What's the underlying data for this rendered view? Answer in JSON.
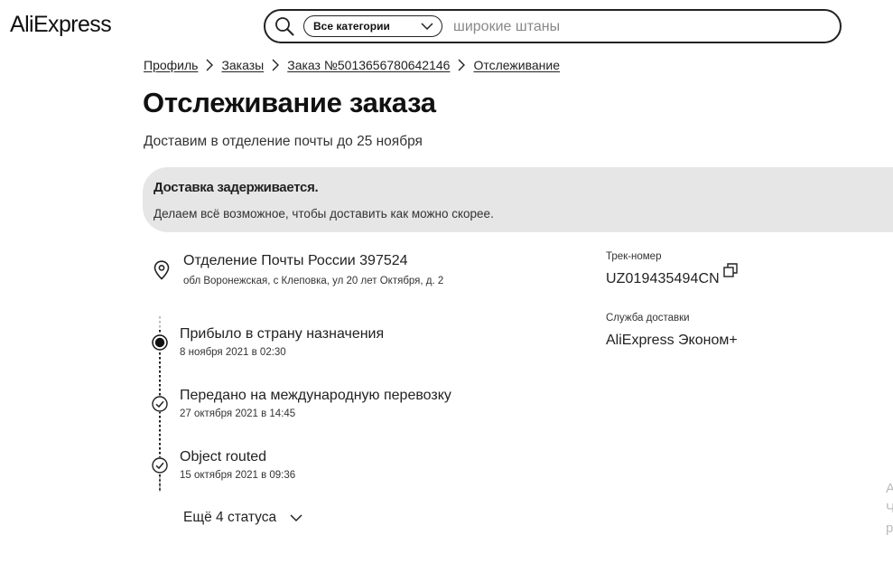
{
  "header": {
    "logo": "AliExpress",
    "search": {
      "category": "Все категории",
      "value": "широкие штаны"
    }
  },
  "breadcrumb": {
    "items": [
      "Профиль",
      "Заказы",
      "Заказ №5013656780642146",
      "Отслеживание"
    ]
  },
  "page": {
    "title": "Отслеживание заказа",
    "subtitle": "Доставим в отделение почты до 25 ноября"
  },
  "alert": {
    "title": "Доставка задерживается.",
    "text": "Делаем всё возможное, чтобы доставить как можно скорее."
  },
  "destination": {
    "title": "Отделение Почты России 397524",
    "address": "обл Воронежская, с Клеповка, ул 20 лет Октября, д. 2"
  },
  "timeline": [
    {
      "title": "Прибыло в страну назначения",
      "date": "8 ноября 2021 в 02:30",
      "state": "current"
    },
    {
      "title": "Передано на международную перевозку",
      "date": "27 октября 2021 в 14:45",
      "state": "done"
    },
    {
      "title": "Object routed",
      "date": "15 октября 2021 в 09:36",
      "state": "done"
    }
  ],
  "more_statuses": "Ещё 4 статуса",
  "tracking": {
    "label": "Трек-номер",
    "number": "UZ019435494CN"
  },
  "delivery": {
    "label": "Служба доставки",
    "service": "AliExpress Эконом+"
  },
  "edge_text": [
    "А",
    "Ч",
    "р"
  ],
  "colors": {
    "text": "#222222",
    "alert_bg": "#e6e6e6",
    "muted": "#888888"
  }
}
